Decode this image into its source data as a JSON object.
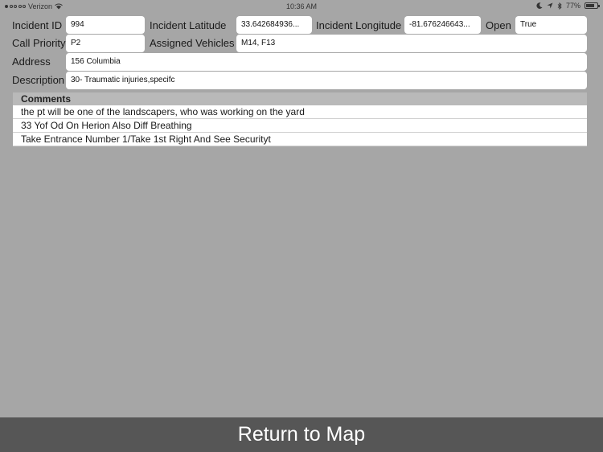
{
  "status_bar": {
    "carrier": "Verizon",
    "time": "10:36 AM",
    "battery": "77%",
    "battery_level": 0.77
  },
  "form": {
    "incident_id_label": "Incident ID",
    "incident_id_value": "994",
    "latitude_label": "Incident Latitude",
    "latitude_value": "33.642684936...",
    "longitude_label": "Incident Longitude",
    "longitude_value": "-81.676246643...",
    "open_label": "Open",
    "open_value": "True",
    "priority_label": "Call Priority",
    "priority_value": "P2",
    "vehicles_label": "Assigned Vehicles",
    "vehicles_value": "M14, F13",
    "address_label": "Address",
    "address_value": "156 Columbia",
    "description_label": "Description",
    "description_value": "30- Traumatic injuries,specifc"
  },
  "comments": {
    "header": "Comments",
    "items": [
      "the pt will be one of  the landscapers, who was working on the yard",
      "33 Yof Od On Herion Also Diff Breathing",
      "Take Entrance Number 1/Take 1st Right And See Securityt"
    ]
  },
  "footer": {
    "return_label": "Return to Map"
  }
}
